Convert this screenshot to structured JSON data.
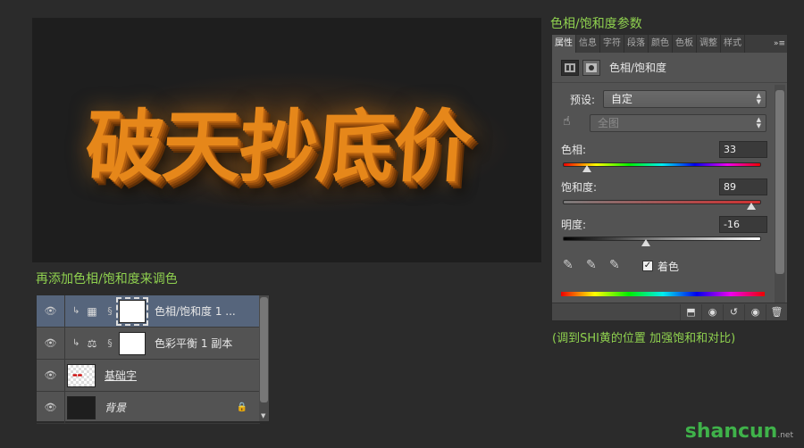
{
  "canvas": {
    "art_text": "破天抄底价"
  },
  "captions": {
    "top": "色相/饱和度参数",
    "left": "再添加色相/饱和度来调色",
    "bottom": "(调到SHI黄的位置 加强饱和和对比)"
  },
  "properties": {
    "tabs": [
      "属性",
      "信息",
      "字符",
      "段落",
      "颜色",
      "色板",
      "调整",
      "样式"
    ],
    "title": "色相/饱和度",
    "preset_label": "预设:",
    "preset_value": "自定",
    "channel_value": "全图",
    "hue_label": "色相:",
    "hue_value": "33",
    "hue_level": 0.12,
    "saturation_label": "饱和度:",
    "saturation_value": "89",
    "saturation_level": 0.95,
    "lightness_label": "明度:",
    "lightness_value": "-16",
    "lightness_level": 0.42,
    "colorize_label": "着色",
    "colorize_checked": true
  },
  "layers": [
    {
      "name": "色相/饱和度 1 ...",
      "type": "hue-sat",
      "selected": true
    },
    {
      "name": "色彩平衡 1 副本",
      "type": "balance",
      "selected": false
    },
    {
      "name": "基础字",
      "type": "text",
      "selected": false
    },
    {
      "name": "背景",
      "type": "background",
      "selected": false,
      "locked": true
    }
  ],
  "watermark": {
    "main": "shancun",
    "sub": ".net"
  },
  "colors": {
    "caption": "#8fd14f",
    "art": "#e6871a",
    "selected_layer": "#56657c"
  }
}
